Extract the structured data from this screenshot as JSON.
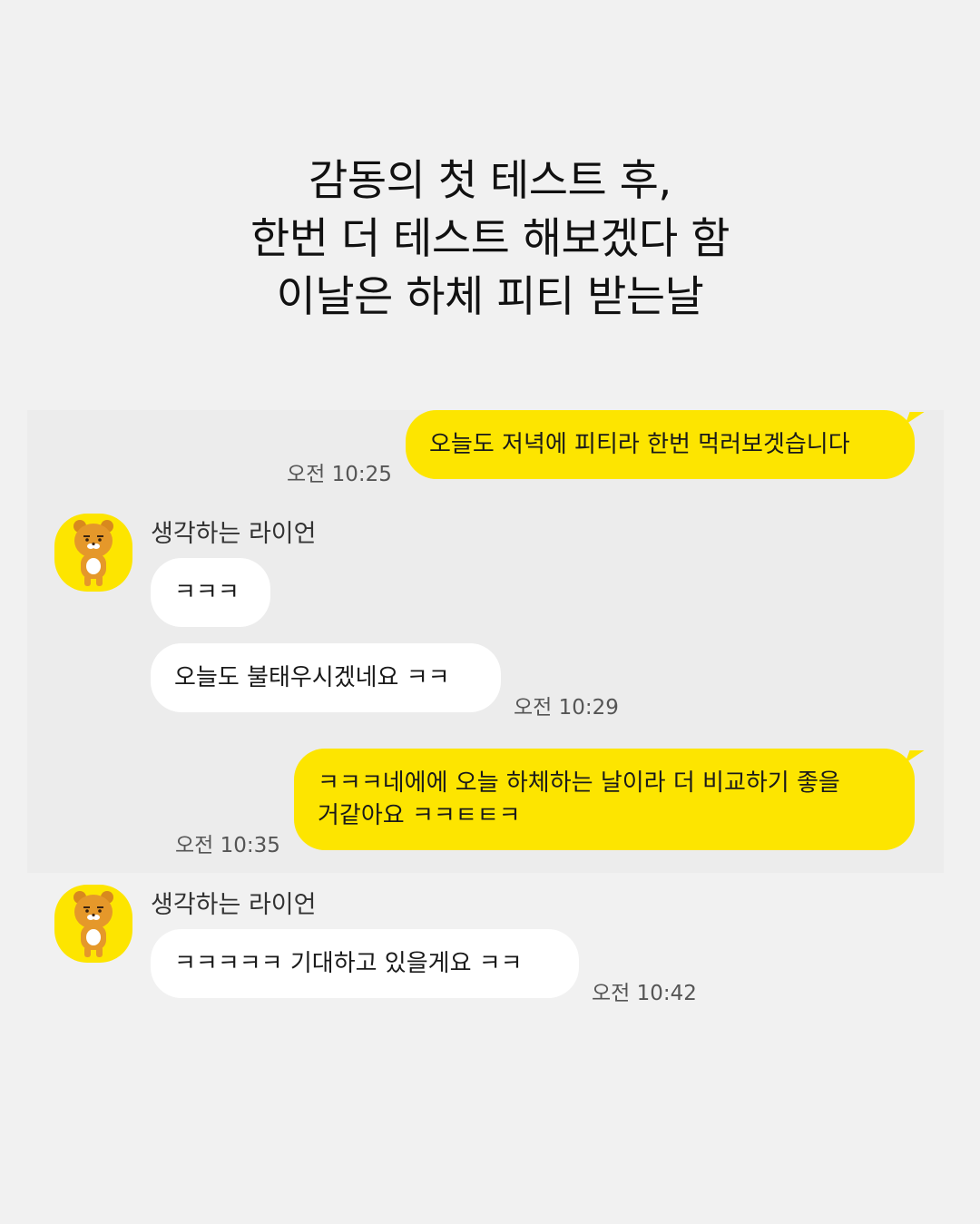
{
  "caption": {
    "line1": "감동의 첫 테스트 후,",
    "line2": "한번 더 테스트 해보겠다 함",
    "line3": "이날은 하체 피티 받는날"
  },
  "chat": {
    "messages": [
      {
        "from": "me",
        "text": "오늘도 저녁에 피티라 한번 먹러보겟습니다",
        "time": "오전 10:25"
      },
      {
        "from": "other",
        "sender": "생각하는 라이언",
        "avatar_icon": "ryan-bear-icon",
        "text": "ㅋㅋㅋ"
      },
      {
        "from": "other",
        "text": "오늘도 불태우시겠네요 ㅋㅋ",
        "time": "오전 10:29"
      },
      {
        "from": "me",
        "text_line1": "ㅋㅋㅋ네에에 오늘 하체하는 날이라 더 비교하기 좋을",
        "text_line2": "거같아요 ㅋㅋㅌㅌㅋ",
        "time": "오전 10:35"
      },
      {
        "from": "other",
        "sender": "생각하는 라이언",
        "avatar_icon": "ryan-bear-icon",
        "text": "ㅋㅋㅋㅋㅋ 기대하고 있을게요 ㅋㅋ",
        "time": "오전 10:42"
      }
    ]
  },
  "colors": {
    "background": "#f1f1f1",
    "my_bubble": "#fde500",
    "other_bubble": "#ffffff",
    "avatar_bg": "#fde500"
  }
}
